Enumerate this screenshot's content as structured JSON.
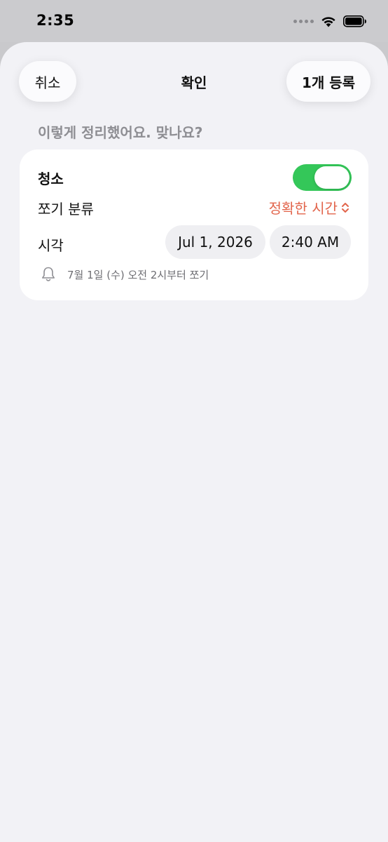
{
  "status_bar": {
    "time": "2:35"
  },
  "sheet": {
    "cancel_label": "취소",
    "title": "확인",
    "register_label": "1개 등록",
    "prompt": "이렇게 정리했어요. 맞나요?"
  },
  "card": {
    "task_name": "청소",
    "toggle_on": true,
    "category_label": "쪼기 분류",
    "category_value": "정확한 시간",
    "time_label": "시각",
    "date_value": "Jul 1, 2026",
    "time_value": "2:40 AM",
    "notify_text": "7월 1일 (수) 오전 2시부터 쪼기"
  },
  "colors": {
    "accent": "#e2654c",
    "toggle_on": "#34c759",
    "background": "#f2f2f6"
  },
  "icons": {
    "signal": "signal-dots-icon",
    "wifi": "wifi-icon",
    "battery": "battery-icon",
    "chevron": "chevron-up-down-icon",
    "bell": "bell-icon"
  }
}
